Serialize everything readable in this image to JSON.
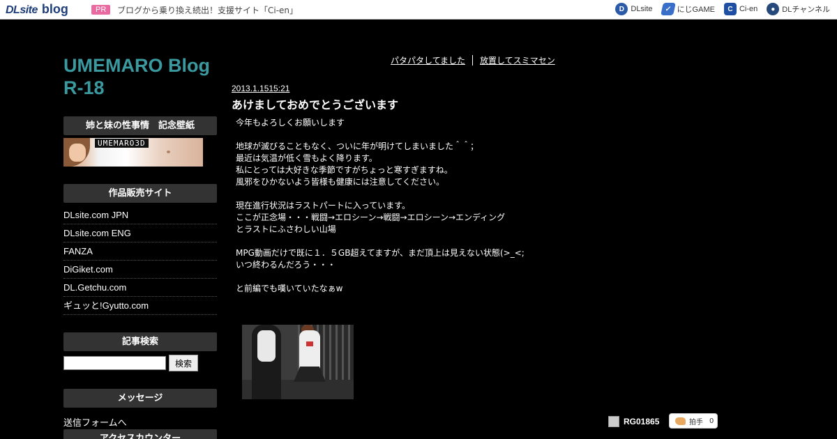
{
  "topbar": {
    "logo_dl": "DLsite",
    "logo_blog": "blog",
    "pr_label": "PR",
    "pr_text": "ブログから乗り換え続出！支援サイト「Ci-en」",
    "links": [
      {
        "label": "DLsite",
        "icon": "dlsite-icon"
      },
      {
        "label": "にじGAME",
        "icon": "niji-game-icon"
      },
      {
        "label": "Ci-en",
        "icon": "ci-en-icon"
      },
      {
        "label": "DLチャンネル",
        "icon": "dl-channel-icon"
      }
    ]
  },
  "sidebar": {
    "blog_title": "UMEMARO Blog R-18",
    "banner_heading": "姉と妹の性事情　記念壁紙",
    "banner_brand": "UMEMARO3D",
    "shops_heading": "作品販売サイト",
    "shops": [
      "DLsite.com JPN",
      "DLsite.com ENG",
      "FANZA",
      "DiGiket.com",
      "DL.Getchu.com",
      "ギュッと!Gyutto.com"
    ],
    "search_heading": "記事検索",
    "search_button": "検索",
    "message_heading": "メッセージ",
    "message_link": "送信フォームへ",
    "counter_heading": "アクセスカウンター"
  },
  "pager": {
    "prev": "パタパタしてました",
    "next": "放置してスミマセン"
  },
  "post": {
    "date": "2013.1.1515:21",
    "title": "あけましておめでとうございます",
    "lines": [
      "今年もよろしくお願いします",
      "",
      "地球が滅びることもなく、ついに年が明けてしまいました＾＾；",
      "最近は気温が低く雪もよく降ります。",
      "私にとっては大好きな季節ですがちょっと寒すぎますね。",
      "風邪をひかないよう皆様も健康には注意してください。",
      "",
      "現在進行状況はラストパートに入っています。",
      "ここが正念場・・・戦闘→エロシーン→戦闘→エロシーン→エンディング",
      "とラストにふさわしい山場",
      "",
      "MPG動画だけで既に１．５GB超えてますが、まだ頂上は見えない状態(>_<;",
      "いつ終わるんだろう・・・",
      "",
      "と前編でも嘆いていたなぁw"
    ],
    "author": "RG01865",
    "clap_label": "拍手",
    "clap_count": "0"
  }
}
